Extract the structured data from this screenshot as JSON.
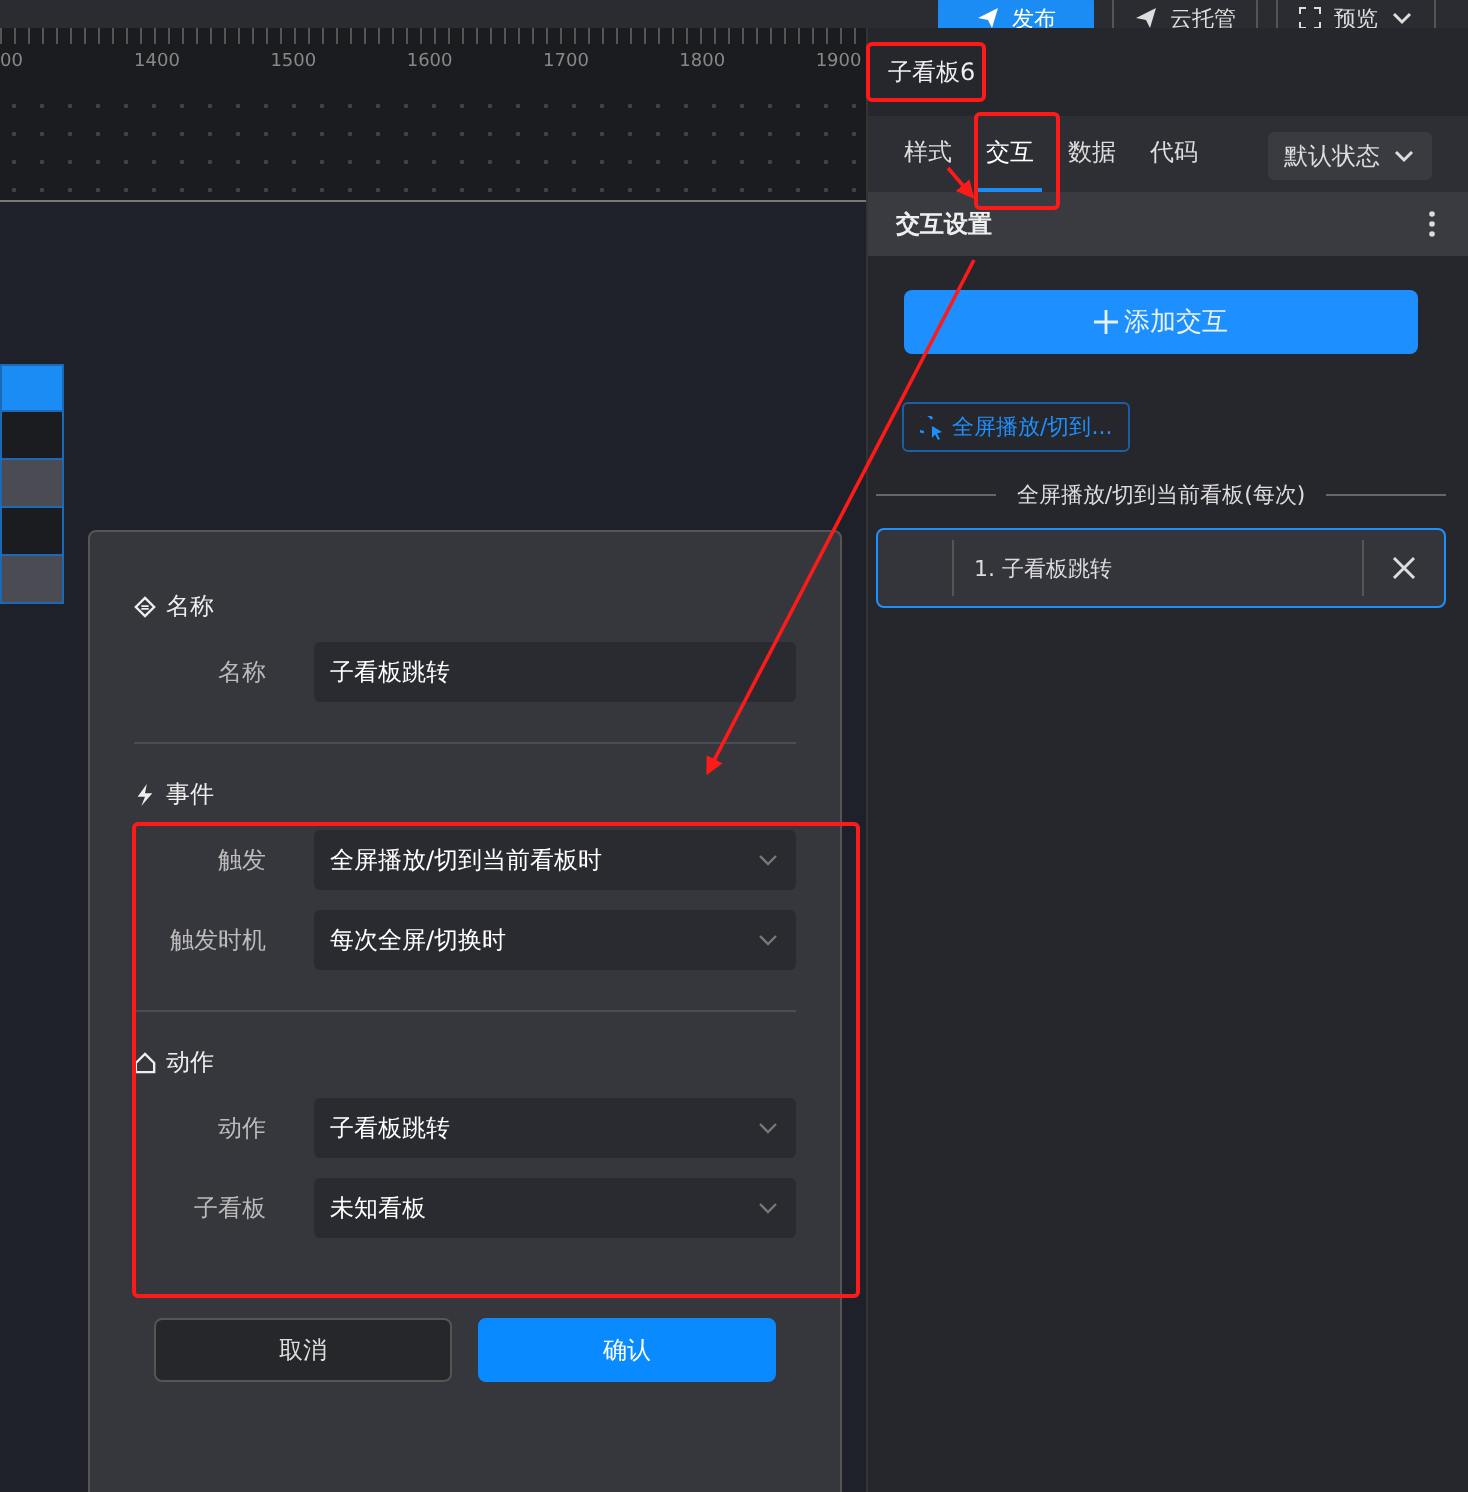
{
  "toolbar": {
    "buttons": [
      {
        "label": "发布",
        "kind": "primary"
      },
      {
        "label": "云托管",
        "kind": "default"
      },
      {
        "label": "预览",
        "kind": "dropdown"
      }
    ]
  },
  "ruler": {
    "labels": [
      "00",
      "1400",
      "1500",
      "1600",
      "1700",
      "1800",
      "1900"
    ]
  },
  "panel": {
    "title": "子看板6",
    "tabs": [
      {
        "label": "样式",
        "selected": false
      },
      {
        "label": "交互",
        "selected": true
      },
      {
        "label": "数据",
        "selected": false
      },
      {
        "label": "代码",
        "selected": false
      }
    ],
    "state_select": {
      "value": "默认状态"
    },
    "section_title": "交互设置",
    "add_button": "添加交互",
    "trigger_chip": "全屏播放/切到...",
    "group_label": "全屏播放/切到当前看板(每次)",
    "items": [
      {
        "label": "1. 子看板跳转",
        "selected": true
      }
    ]
  },
  "dialog": {
    "sections": [
      {
        "title": "名称",
        "fields": [
          {
            "label": "名称",
            "value": "子看板跳转",
            "kind": "input"
          }
        ]
      },
      {
        "title": "事件",
        "fields": [
          {
            "label": "触发",
            "value": "全屏播放/切到当前看板时",
            "kind": "select"
          },
          {
            "label": "触发时机",
            "value": "每次全屏/切换时",
            "kind": "select"
          }
        ]
      },
      {
        "title": "动作",
        "fields": [
          {
            "label": "动作",
            "value": "子看板跳转",
            "kind": "select"
          },
          {
            "label": "子看板",
            "value": "未知看板",
            "kind": "select"
          }
        ]
      }
    ],
    "buttons": [
      {
        "label": "取消",
        "kind": "secondary"
      },
      {
        "label": "确认",
        "kind": "primary"
      }
    ]
  }
}
